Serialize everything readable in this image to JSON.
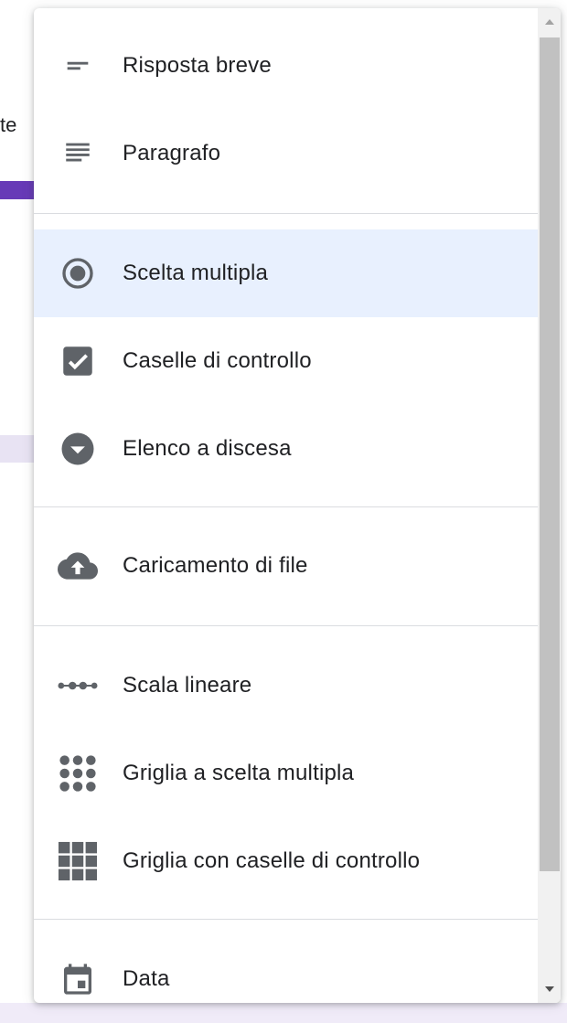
{
  "background": {
    "fragment_text": "te"
  },
  "menu": {
    "groups": [
      {
        "items": [
          {
            "label": "Risposta breve",
            "icon": "short-answer-icon"
          },
          {
            "label": "Paragrafo",
            "icon": "paragraph-icon"
          }
        ]
      },
      {
        "items": [
          {
            "label": "Scelta multipla",
            "icon": "radio-button-icon",
            "selected": true
          },
          {
            "label": "Caselle di controllo",
            "icon": "checkbox-icon"
          },
          {
            "label": "Elenco a discesa",
            "icon": "dropdown-icon"
          }
        ]
      },
      {
        "items": [
          {
            "label": "Caricamento di file",
            "icon": "cloud-upload-icon"
          }
        ]
      },
      {
        "items": [
          {
            "label": "Scala lineare",
            "icon": "linear-scale-icon"
          },
          {
            "label": "Griglia a scelta multipla",
            "icon": "dot-grid-icon"
          },
          {
            "label": "Griglia con caselle di controllo",
            "icon": "checkbox-grid-icon"
          }
        ]
      },
      {
        "items": [
          {
            "label": "Data",
            "icon": "calendar-icon"
          }
        ]
      }
    ]
  },
  "colors": {
    "icon": "#5f6368",
    "text": "#202124",
    "selected_bg": "#e8f0fe",
    "divider": "#dadce0",
    "accent": "#673ab7"
  }
}
